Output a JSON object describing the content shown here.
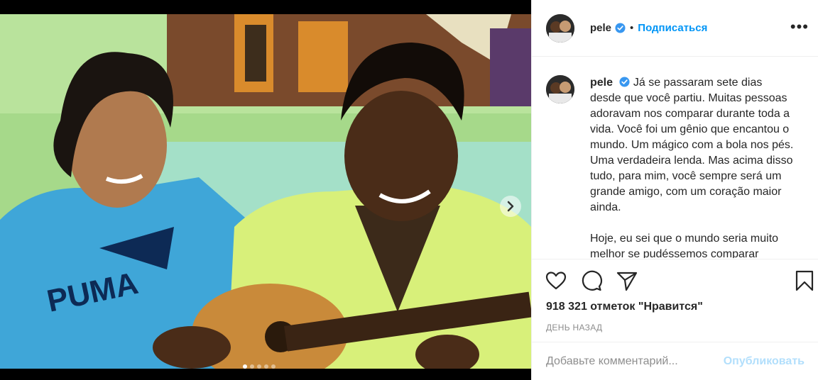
{
  "post": {
    "username": "pele",
    "follow_label": "Подписаться",
    "separator": "•",
    "more_label": "•••",
    "caption_p1": "Já se passaram sete dias desde que você partiu. Muitas pessoas adoravam nos comparar durante toda a vida. Você foi um gênio que encantou o mundo. Um mágico com a bola nos pés. Uma verdadeira lenda. Mas acima disso tudo, para mim, você sempre será um grande amigo, com um coração maior ainda.",
    "caption_p2": "Hoje, eu sei que o mundo seria muito melhor se pudéssemos comparar",
    "likes": "918 321 отметок \"Нравится\"",
    "timestamp": "ДЕНЬ НАЗАД",
    "comment_placeholder": "Добавьте комментарий...",
    "post_label": "Опубликовать"
  },
  "carousel": {
    "slide_count": 5,
    "active_slide": 1
  },
  "icons": {
    "like": "heart-icon",
    "comment": "comment-icon",
    "share": "paper-plane-icon",
    "save": "bookmark-icon",
    "verified": "verified-badge-icon",
    "next": "chevron-right-icon"
  },
  "colors": {
    "accent": "#0095f6",
    "post_disabled": "#b2dffc",
    "verified": "#3897f0"
  }
}
